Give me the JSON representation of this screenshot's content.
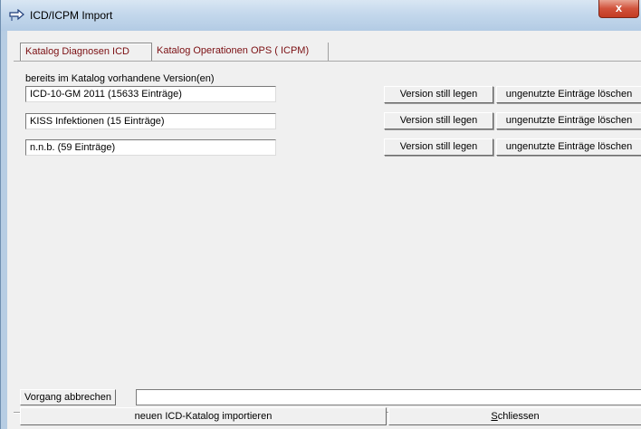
{
  "window": {
    "title": "ICD/ICPM Import",
    "close_glyph": "x"
  },
  "tabs": [
    {
      "label": "Katalog Diagnosen ICD",
      "active": true
    },
    {
      "label": "Katalog Operationen OPS ( ICPM)",
      "active": false
    }
  ],
  "versions": {
    "label": "bereits im Katalog vorhandene Version(en)",
    "items": [
      {
        "name": "ICD-10-GM 2011 (15633 Einträge)",
        "retire_label": "Version still legen",
        "delete_label": "ungenutzte Einträge löschen"
      },
      {
        "name": "KISS Infektionen (15 Einträge)",
        "retire_label": "Version still legen",
        "delete_label": "ungenutzte Einträge löschen"
      },
      {
        "name": "n.n.b. (59 Einträge)",
        "retire_label": "Version still legen",
        "delete_label": "ungenutzte Einträge löschen"
      }
    ]
  },
  "footer": {
    "cancel_label": "Vorgang abbrechen",
    "status_text": "",
    "import_label": "neuen ICD-Katalog importieren",
    "close_label_mnemonic": "S",
    "close_label_rest": "chliessen"
  },
  "icons": {
    "app": "arrow-exchange-icon",
    "close": "close-icon"
  }
}
